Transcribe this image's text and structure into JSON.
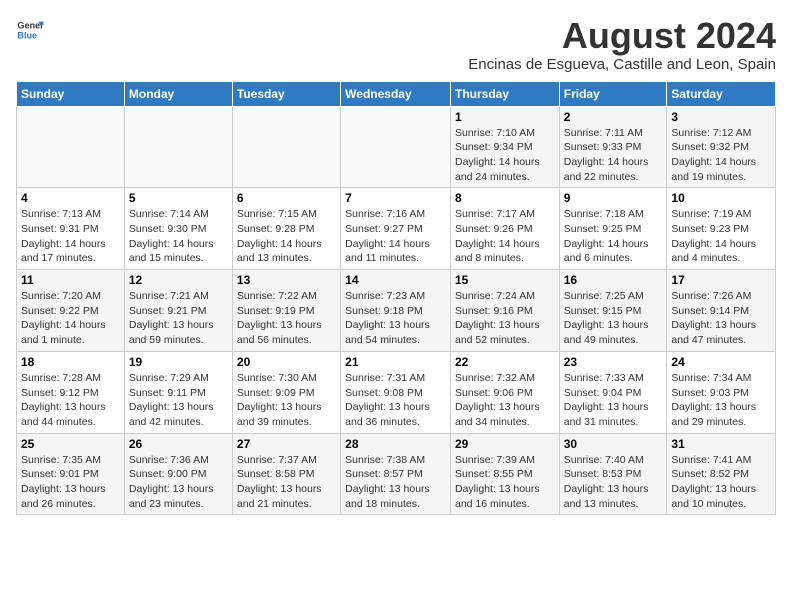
{
  "logo": {
    "line1": "General",
    "line2": "Blue"
  },
  "title": "August 2024",
  "subtitle": "Encinas de Esgueva, Castille and Leon, Spain",
  "days_of_week": [
    "Sunday",
    "Monday",
    "Tuesday",
    "Wednesday",
    "Thursday",
    "Friday",
    "Saturday"
  ],
  "weeks": [
    [
      {
        "day": "",
        "info": ""
      },
      {
        "day": "",
        "info": ""
      },
      {
        "day": "",
        "info": ""
      },
      {
        "day": "",
        "info": ""
      },
      {
        "day": "1",
        "info": "Sunrise: 7:10 AM\nSunset: 9:34 PM\nDaylight: 14 hours and 24 minutes."
      },
      {
        "day": "2",
        "info": "Sunrise: 7:11 AM\nSunset: 9:33 PM\nDaylight: 14 hours and 22 minutes."
      },
      {
        "day": "3",
        "info": "Sunrise: 7:12 AM\nSunset: 9:32 PM\nDaylight: 14 hours and 19 minutes."
      }
    ],
    [
      {
        "day": "4",
        "info": "Sunrise: 7:13 AM\nSunset: 9:31 PM\nDaylight: 14 hours and 17 minutes."
      },
      {
        "day": "5",
        "info": "Sunrise: 7:14 AM\nSunset: 9:30 PM\nDaylight: 14 hours and 15 minutes."
      },
      {
        "day": "6",
        "info": "Sunrise: 7:15 AM\nSunset: 9:28 PM\nDaylight: 14 hours and 13 minutes."
      },
      {
        "day": "7",
        "info": "Sunrise: 7:16 AM\nSunset: 9:27 PM\nDaylight: 14 hours and 11 minutes."
      },
      {
        "day": "8",
        "info": "Sunrise: 7:17 AM\nSunset: 9:26 PM\nDaylight: 14 hours and 8 minutes."
      },
      {
        "day": "9",
        "info": "Sunrise: 7:18 AM\nSunset: 9:25 PM\nDaylight: 14 hours and 6 minutes."
      },
      {
        "day": "10",
        "info": "Sunrise: 7:19 AM\nSunset: 9:23 PM\nDaylight: 14 hours and 4 minutes."
      }
    ],
    [
      {
        "day": "11",
        "info": "Sunrise: 7:20 AM\nSunset: 9:22 PM\nDaylight: 14 hours and 1 minute."
      },
      {
        "day": "12",
        "info": "Sunrise: 7:21 AM\nSunset: 9:21 PM\nDaylight: 13 hours and 59 minutes."
      },
      {
        "day": "13",
        "info": "Sunrise: 7:22 AM\nSunset: 9:19 PM\nDaylight: 13 hours and 56 minutes."
      },
      {
        "day": "14",
        "info": "Sunrise: 7:23 AM\nSunset: 9:18 PM\nDaylight: 13 hours and 54 minutes."
      },
      {
        "day": "15",
        "info": "Sunrise: 7:24 AM\nSunset: 9:16 PM\nDaylight: 13 hours and 52 minutes."
      },
      {
        "day": "16",
        "info": "Sunrise: 7:25 AM\nSunset: 9:15 PM\nDaylight: 13 hours and 49 minutes."
      },
      {
        "day": "17",
        "info": "Sunrise: 7:26 AM\nSunset: 9:14 PM\nDaylight: 13 hours and 47 minutes."
      }
    ],
    [
      {
        "day": "18",
        "info": "Sunrise: 7:28 AM\nSunset: 9:12 PM\nDaylight: 13 hours and 44 minutes."
      },
      {
        "day": "19",
        "info": "Sunrise: 7:29 AM\nSunset: 9:11 PM\nDaylight: 13 hours and 42 minutes."
      },
      {
        "day": "20",
        "info": "Sunrise: 7:30 AM\nSunset: 9:09 PM\nDaylight: 13 hours and 39 minutes."
      },
      {
        "day": "21",
        "info": "Sunrise: 7:31 AM\nSunset: 9:08 PM\nDaylight: 13 hours and 36 minutes."
      },
      {
        "day": "22",
        "info": "Sunrise: 7:32 AM\nSunset: 9:06 PM\nDaylight: 13 hours and 34 minutes."
      },
      {
        "day": "23",
        "info": "Sunrise: 7:33 AM\nSunset: 9:04 PM\nDaylight: 13 hours and 31 minutes."
      },
      {
        "day": "24",
        "info": "Sunrise: 7:34 AM\nSunset: 9:03 PM\nDaylight: 13 hours and 29 minutes."
      }
    ],
    [
      {
        "day": "25",
        "info": "Sunrise: 7:35 AM\nSunset: 9:01 PM\nDaylight: 13 hours and 26 minutes."
      },
      {
        "day": "26",
        "info": "Sunrise: 7:36 AM\nSunset: 9:00 PM\nDaylight: 13 hours and 23 minutes."
      },
      {
        "day": "27",
        "info": "Sunrise: 7:37 AM\nSunset: 8:58 PM\nDaylight: 13 hours and 21 minutes."
      },
      {
        "day": "28",
        "info": "Sunrise: 7:38 AM\nSunset: 8:57 PM\nDaylight: 13 hours and 18 minutes."
      },
      {
        "day": "29",
        "info": "Sunrise: 7:39 AM\nSunset: 8:55 PM\nDaylight: 13 hours and 16 minutes."
      },
      {
        "day": "30",
        "info": "Sunrise: 7:40 AM\nSunset: 8:53 PM\nDaylight: 13 hours and 13 minutes."
      },
      {
        "day": "31",
        "info": "Sunrise: 7:41 AM\nSunset: 8:52 PM\nDaylight: 13 hours and 10 minutes."
      }
    ]
  ]
}
